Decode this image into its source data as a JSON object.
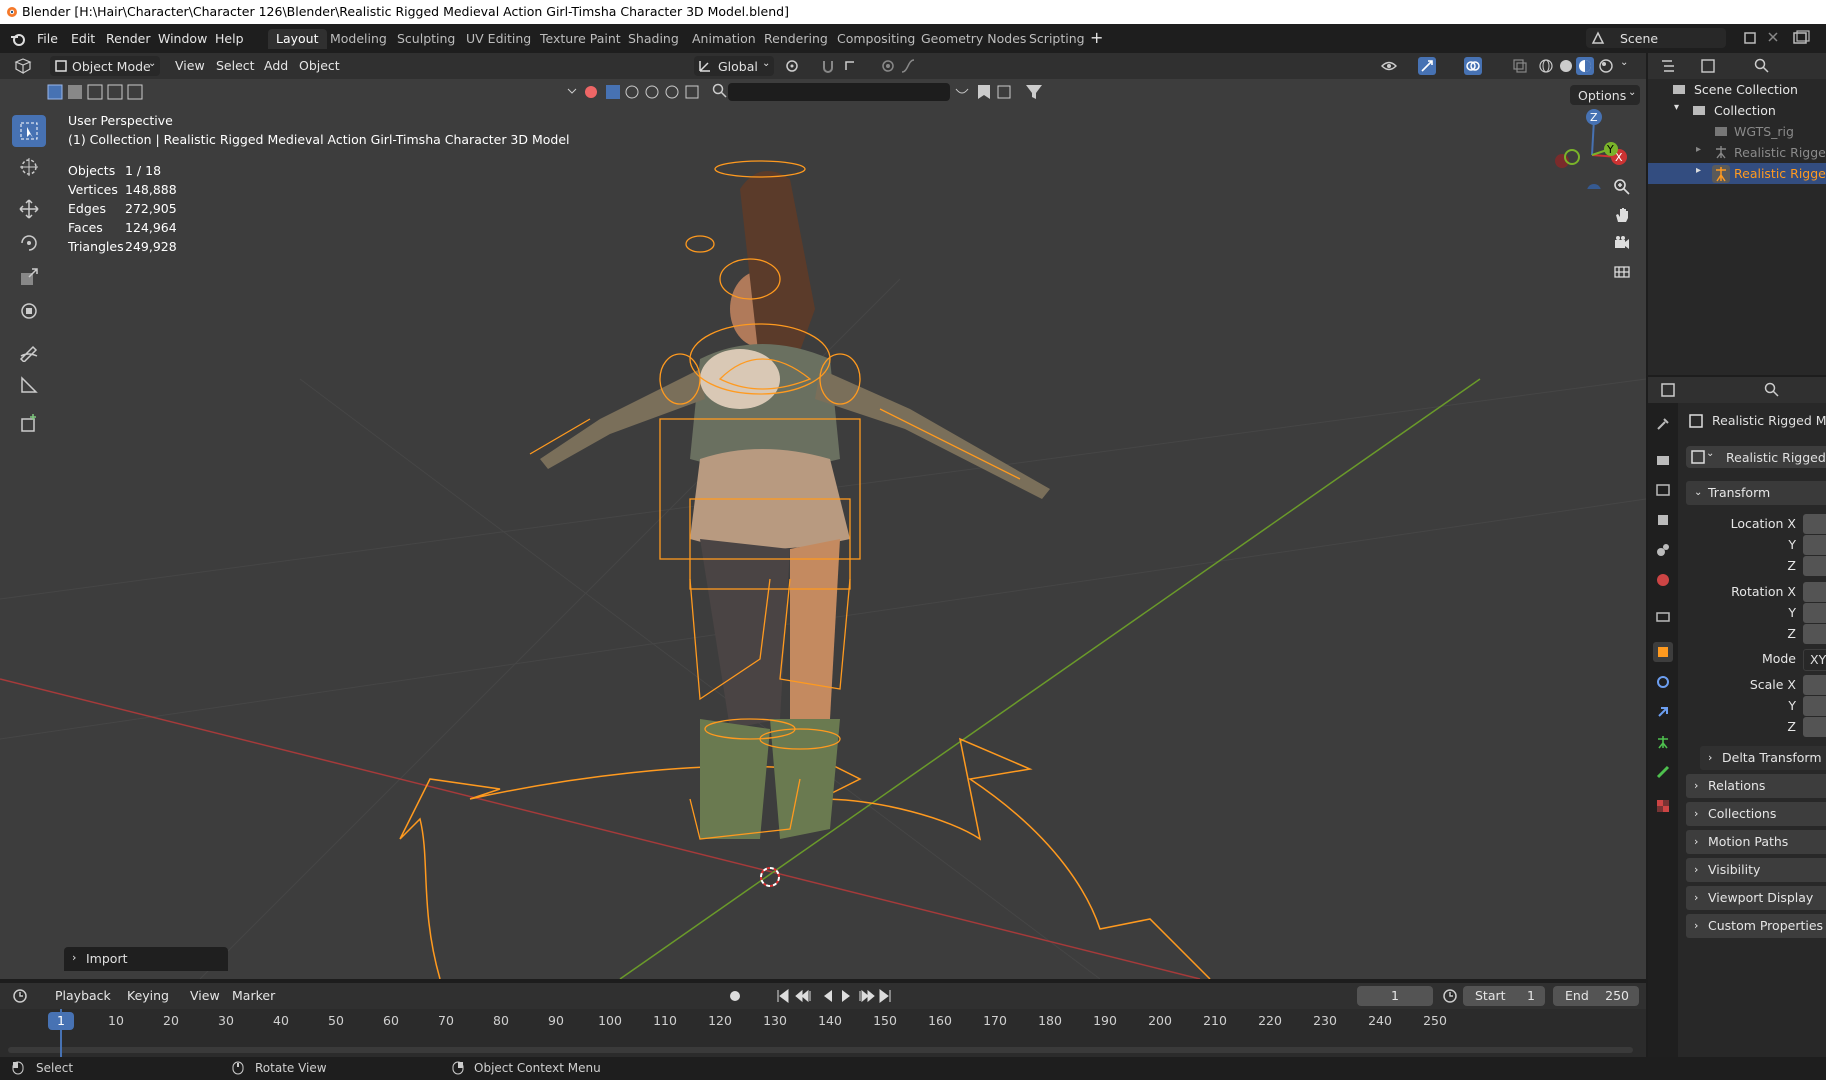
{
  "window": {
    "title": "Blender [H:\\Hair\\Character\\Character 126\\Blender\\Realistic Rigged Medieval Action Girl-Timsha Character 3D Model.blend]"
  },
  "menu": {
    "file": "File",
    "edit": "Edit",
    "render": "Render",
    "window": "Window",
    "help": "Help"
  },
  "workspaces": [
    "Layout",
    "Modeling",
    "Sculpting",
    "UV Editing",
    "Texture Paint",
    "Shading",
    "Animation",
    "Rendering",
    "Compositing",
    "Geometry Nodes",
    "Scripting"
  ],
  "scene": {
    "label": "Scene"
  },
  "viewport_header": {
    "mode": "Object Mode",
    "view": "View",
    "select": "Select",
    "add": "Add",
    "object": "Object",
    "orientation": "Global",
    "options": "Options"
  },
  "viewport": {
    "perspective": "User Perspective",
    "collection_line": "(1) Collection | Realistic Rigged Medieval Action Girl-Timsha Character 3D Model",
    "stats": [
      {
        "label": "Objects",
        "value": "1 / 18"
      },
      {
        "label": "Vertices",
        "value": "148,888"
      },
      {
        "label": "Edges",
        "value": "272,905"
      },
      {
        "label": "Faces",
        "value": "124,964"
      },
      {
        "label": "Triangles",
        "value": "249,928"
      }
    ],
    "import_panel": "Import",
    "gizmo": {
      "x": "X",
      "y": "Y",
      "z": "Z"
    }
  },
  "outliner": {
    "scene_collection": "Scene Collection",
    "collection": "Collection",
    "items": [
      "WGTS_rig",
      "Realistic Rigged Me",
      "Realistic Rigged Me"
    ]
  },
  "properties": {
    "object_name": "Realistic Rigged Medi...",
    "data_name": "Realistic Rigged Me",
    "transform": "Transform",
    "location_x": "Location X",
    "loc_y": "Y",
    "loc_z": "Z",
    "rotation_x": "Rotation X",
    "rot_y": "Y",
    "rot_z": "Z",
    "mode": "Mode",
    "mode_value": "XY",
    "scale_x": "Scale X",
    "scale_y": "Y",
    "scale_z": "Z",
    "delta_transform": "Delta Transform",
    "panels": [
      "Relations",
      "Collections",
      "Motion Paths",
      "Visibility",
      "Viewport Display",
      "Custom Properties"
    ]
  },
  "timeline": {
    "playback": "Playback",
    "keying": "Keying",
    "view": "View",
    "marker": "Marker",
    "current_frame": "1",
    "start_label": "Start",
    "start_value": "1",
    "end_label": "End",
    "end_value": "250",
    "ticks": [
      "1",
      "10",
      "20",
      "30",
      "40",
      "50",
      "60",
      "70",
      "80",
      "90",
      "100",
      "110",
      "120",
      "130",
      "140",
      "150",
      "160",
      "170",
      "180",
      "190",
      "200",
      "210",
      "220",
      "230",
      "240",
      "250"
    ]
  },
  "status": {
    "select": "Select",
    "rotate": "Rotate View",
    "context": "Object Context Menu"
  },
  "colors": {
    "accent": "#4772b3",
    "selection_orange": "#ff9a1f",
    "axis_red": "#a63a3a",
    "axis_green": "#6a9a2a"
  }
}
